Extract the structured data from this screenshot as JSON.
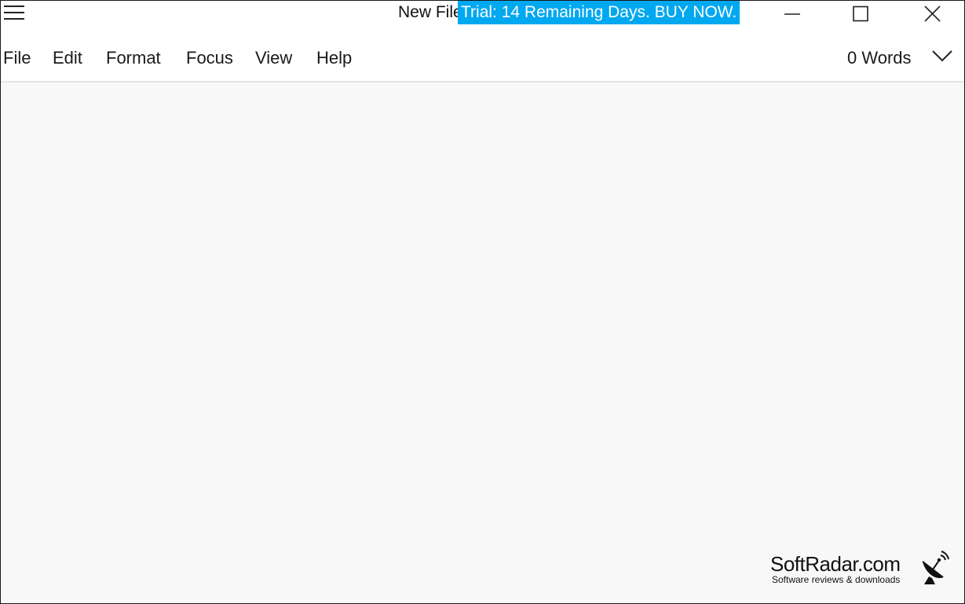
{
  "window": {
    "title": "New File",
    "trial_banner": "Trial: 14 Remaining Days. BUY NOW.",
    "accent_color": "#00a8f0"
  },
  "menu": {
    "items": [
      "File",
      "Edit",
      "Format",
      "Focus",
      "View",
      "Help"
    ]
  },
  "status": {
    "word_count": "0 Words"
  },
  "icons": {
    "menu": "hamburger-menu-icon",
    "minimize": "minimize-icon",
    "maximize": "maximize-icon",
    "close": "close-icon",
    "dropdown": "chevron-down-icon"
  },
  "editor": {
    "content": ""
  },
  "watermark": {
    "name": "SoftRadar.com",
    "tagline": "Software reviews & downloads"
  }
}
